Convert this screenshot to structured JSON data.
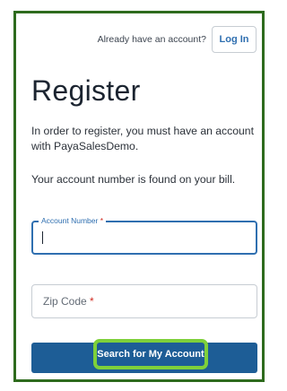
{
  "header": {
    "have_account_text": "Already have an account?",
    "login_label": "Log In"
  },
  "main": {
    "title": "Register",
    "intro": "In order to register, you must have an account with PayaSalesDemo.",
    "account_hint": "Your account number is found on your bill."
  },
  "form": {
    "account_number": {
      "label": "Account Number",
      "required_mark": "*",
      "value": ""
    },
    "zip_code": {
      "placeholder": "Zip Code",
      "required_mark": "*",
      "value": ""
    },
    "submit_label": "Search for My Account"
  },
  "colors": {
    "accent_blue": "#2f6fb0",
    "button_blue": "#1d5d96",
    "highlight_green": "#7ed03a",
    "frame_green": "#2e6b1d",
    "required_red": "#d0291f"
  }
}
